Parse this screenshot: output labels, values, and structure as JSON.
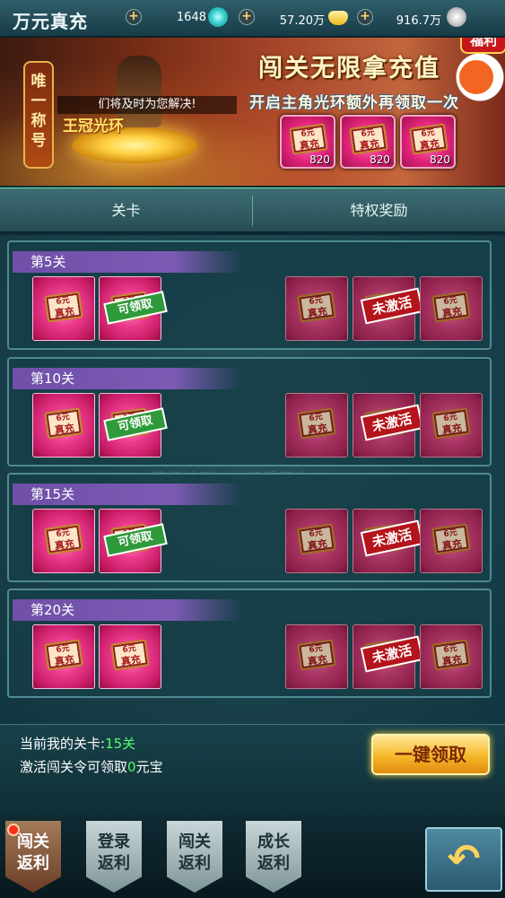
{
  "header": {
    "title": "万元真充",
    "resources": [
      {
        "name": "jade",
        "value": "1648",
        "icon": "jade-icon"
      },
      {
        "name": "gold",
        "value": "57.20万",
        "icon": "gold-ingot-icon"
      },
      {
        "name": "silver",
        "value": "916.7万",
        "icon": "coin-icon"
      }
    ],
    "plus_symbol": "+"
  },
  "banner": {
    "badge": "唯一称号",
    "hero_caption": "们将及时为您解决!",
    "hero_ring": "王冠光环",
    "title": "闯关无限拿充值",
    "subtitle": "开启主角光环额外再领取一次",
    "fuli": "福利",
    "reward_cards": [
      {
        "ticket_top": "6元",
        "ticket_bottom": "真充",
        "count": "820"
      },
      {
        "ticket_top": "6元",
        "ticket_bottom": "真充",
        "count": "820"
      },
      {
        "ticket_top": "6元",
        "ticket_bottom": "真充",
        "count": "820"
      }
    ]
  },
  "tabs": [
    {
      "label": "关卡",
      "active": true
    },
    {
      "label": "特权奖励",
      "active": false
    }
  ],
  "overlay_note": "等级达到100级后开启",
  "ticket": {
    "top": "6元",
    "bottom": "真充"
  },
  "stamps": {
    "claim": "可领取",
    "inactive": "未激活"
  },
  "stages": [
    {
      "label": "第5关",
      "claimable": true
    },
    {
      "label": "第10关",
      "claimable": true
    },
    {
      "label": "第15关",
      "claimable": true
    },
    {
      "label": "第20关",
      "claimable": false
    }
  ],
  "info": {
    "current_stage_label": "当前我的关卡:",
    "current_stage_value": "15关",
    "activate_prefix": "激活闯关令可领取",
    "activate_value": "0",
    "activate_suffix": "元宝",
    "claim_all_button": "一键领取"
  },
  "bottom_nav": [
    {
      "line1": "闯关",
      "line2": "返利",
      "active": true
    },
    {
      "line1": "登录",
      "line2": "返利",
      "active": false
    },
    {
      "line1": "闯关",
      "line2": "返利",
      "active": false
    },
    {
      "line1": "成长",
      "line2": "返利",
      "active": false
    }
  ],
  "colors": {
    "accent_gold": "#f5b82a",
    "claim_green": "#2f9a3a",
    "inactive_red": "#b4141b",
    "stage_purple": "#7c5bb5",
    "highlight_green": "#4fff6a"
  }
}
